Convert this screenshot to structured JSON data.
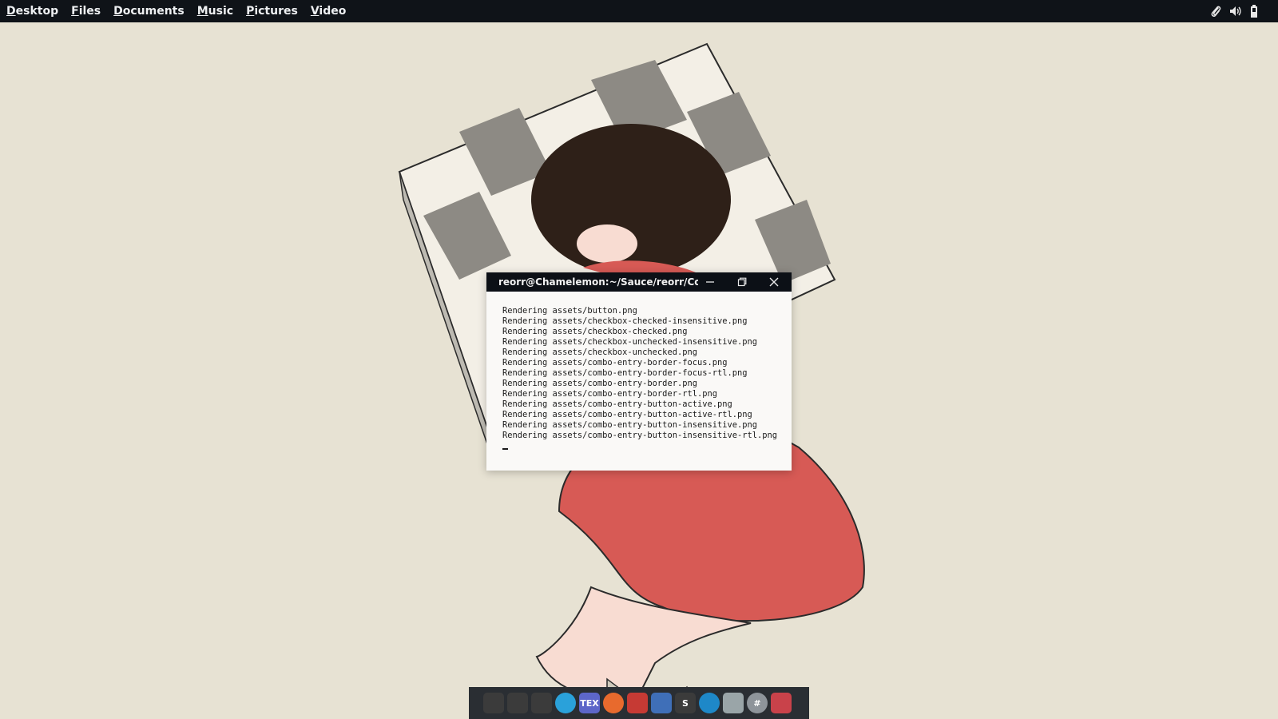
{
  "topbar": {
    "menu": [
      {
        "first": "D",
        "rest": "esktop"
      },
      {
        "first": "F",
        "rest": "iles"
      },
      {
        "first": "D",
        "rest": "ocuments"
      },
      {
        "first": "M",
        "rest": "usic"
      },
      {
        "first": "P",
        "rest": "ictures"
      },
      {
        "first": "V",
        "rest": "ideo"
      }
    ],
    "tray": [
      "paperclip-icon",
      "volume-icon",
      "battery-icon"
    ]
  },
  "terminal": {
    "title": "reorr@Chamelemon:~/Sauce/reorr/Colorize",
    "lines": [
      "Rendering assets/button.png",
      "Rendering assets/checkbox-checked-insensitive.png",
      "Rendering assets/checkbox-checked.png",
      "Rendering assets/checkbox-unchecked-insensitive.png",
      "Rendering assets/checkbox-unchecked.png",
      "Rendering assets/combo-entry-border-focus.png",
      "Rendering assets/combo-entry-border-focus-rtl.png",
      "Rendering assets/combo-entry-border.png",
      "Rendering assets/combo-entry-border-rtl.png",
      "Rendering assets/combo-entry-button-active.png",
      "Rendering assets/combo-entry-button-active-rtl.png",
      "Rendering assets/combo-entry-button-insensitive.png",
      "Rendering assets/combo-entry-button-insensitive-rtl.png"
    ]
  },
  "dock": {
    "items": [
      {
        "icon": "gimp-icon",
        "glyph": "",
        "color": "#3b3b3b"
      },
      {
        "icon": "inkscape-icon",
        "glyph": "",
        "color": "#3b3b3b"
      },
      {
        "icon": "palette-icon",
        "glyph": "",
        "color": "#3b3b3b"
      },
      {
        "icon": "telegram-icon",
        "glyph": "",
        "color": "#2aa1da"
      },
      {
        "icon": "tex-icon",
        "glyph": "TEX",
        "color": "#5d66c9"
      },
      {
        "icon": "firefox-icon",
        "glyph": "",
        "color": "#e86a2d"
      },
      {
        "icon": "transmission-icon",
        "glyph": "",
        "color": "#c63a34"
      },
      {
        "icon": "notebook-icon",
        "glyph": "",
        "color": "#3f6fb8"
      },
      {
        "icon": "sublime-text-icon",
        "glyph": "S",
        "color": "#3b3b3b"
      },
      {
        "icon": "search-icon",
        "glyph": "",
        "color": "#1e88c8"
      },
      {
        "icon": "file-manager-icon",
        "glyph": "",
        "color": "#9aa5a8"
      },
      {
        "icon": "hashtag-icon",
        "glyph": "#",
        "color": "#8e949a"
      },
      {
        "icon": "anime-avatar-icon",
        "glyph": "",
        "color": "#c9424a"
      }
    ]
  }
}
